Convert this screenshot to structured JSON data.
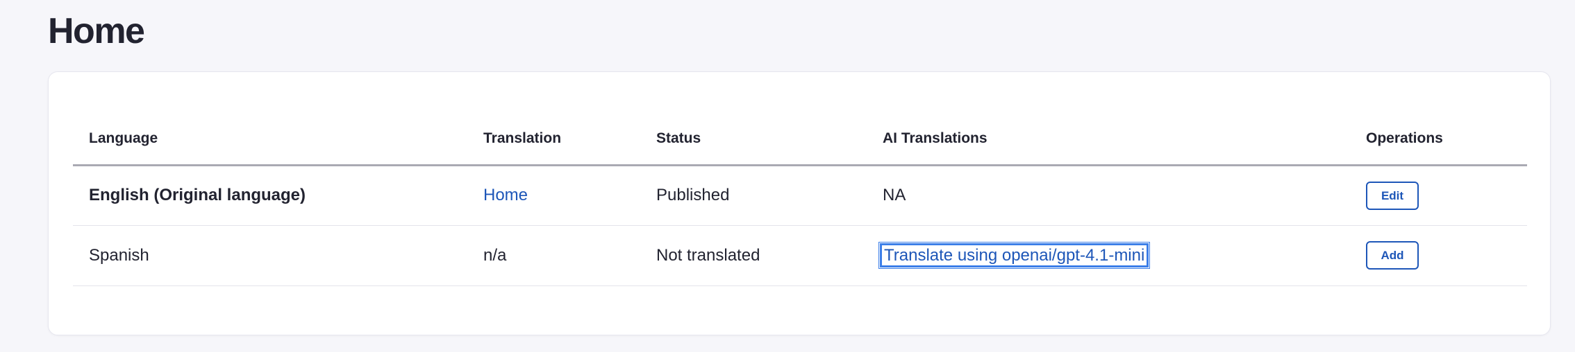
{
  "page": {
    "title": "Home"
  },
  "table": {
    "headers": {
      "language": "Language",
      "translation": "Translation",
      "status": "Status",
      "ai_translations": "AI Translations",
      "operations": "Operations"
    },
    "rows": [
      {
        "language": "English (Original language)",
        "translation": "Home",
        "status": "Published",
        "ai_translation": "NA",
        "operation": "Edit"
      },
      {
        "language": "Spanish",
        "translation": "n/a",
        "status": "Not translated",
        "ai_translation": "Translate using openai/gpt-4.1-mini",
        "operation": "Add"
      }
    ]
  },
  "colors": {
    "link": "#1d56b8",
    "focus_ring": "#3b7ee8",
    "background": "#f6f6fa"
  }
}
